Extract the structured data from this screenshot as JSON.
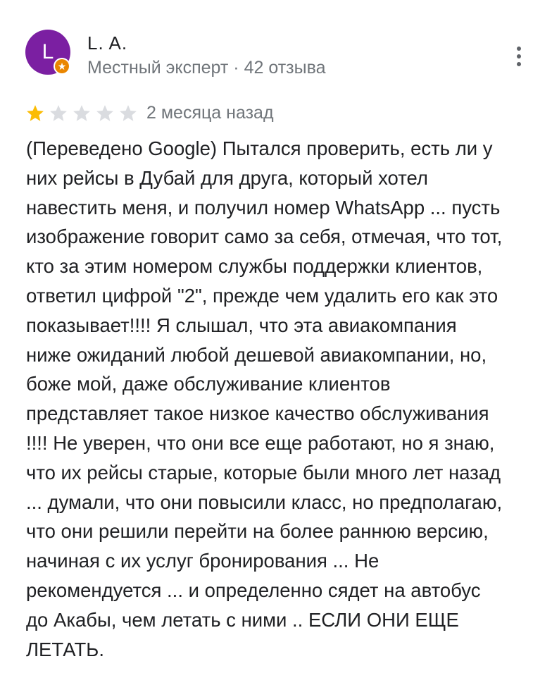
{
  "author": {
    "initial": "L",
    "name": "L. A.",
    "meta": "Местный эксперт · 42 отзыва",
    "avatar_color": "#7b1fa2",
    "badge_icon": "local-guide-star-icon"
  },
  "menu": {
    "icon": "more-vert-icon"
  },
  "rating": {
    "value": 1,
    "max": 5,
    "filled_color": "#fbbc04",
    "empty_color": "#dadce0"
  },
  "date": "2 месяца назад",
  "review_lines": [
    "(Переведено Google) Пытался проверить, есть ли у",
    "них рейсы в Дубай для друга, который хотел",
    "навестить меня, и получил номер WhatsApp ... пусть",
    "изображение говорит само за себя, отмечая, что тот,",
    "кто за этим номером службы поддержки клиентов,",
    "ответил цифрой \"2\", прежде чем удалить его как это",
    "показывает!!!! Я слышал, что эта авиакомпания",
    "ниже ожиданий любой дешевой авиакомпании, но,",
    "боже мой, даже обслуживание клиентов",
    "представляет такое низкое качество обслуживания",
    "!!!! Не уверен, что они все еще работают, но я знаю,",
    "что их рейсы старые, которые были много лет назад",
    "... думали, что они повысили класс, но предполагаю,",
    "что они решили перейти на более раннюю версию,",
    "начиная с их услуг бронирования ... Не",
    "рекомендуется ... и определенно сядет на автобус",
    "до Акабы, чем летать с ними .. ЕСЛИ ОНИ ЕЩЕ",
    "ЛЕТАТЬ."
  ]
}
